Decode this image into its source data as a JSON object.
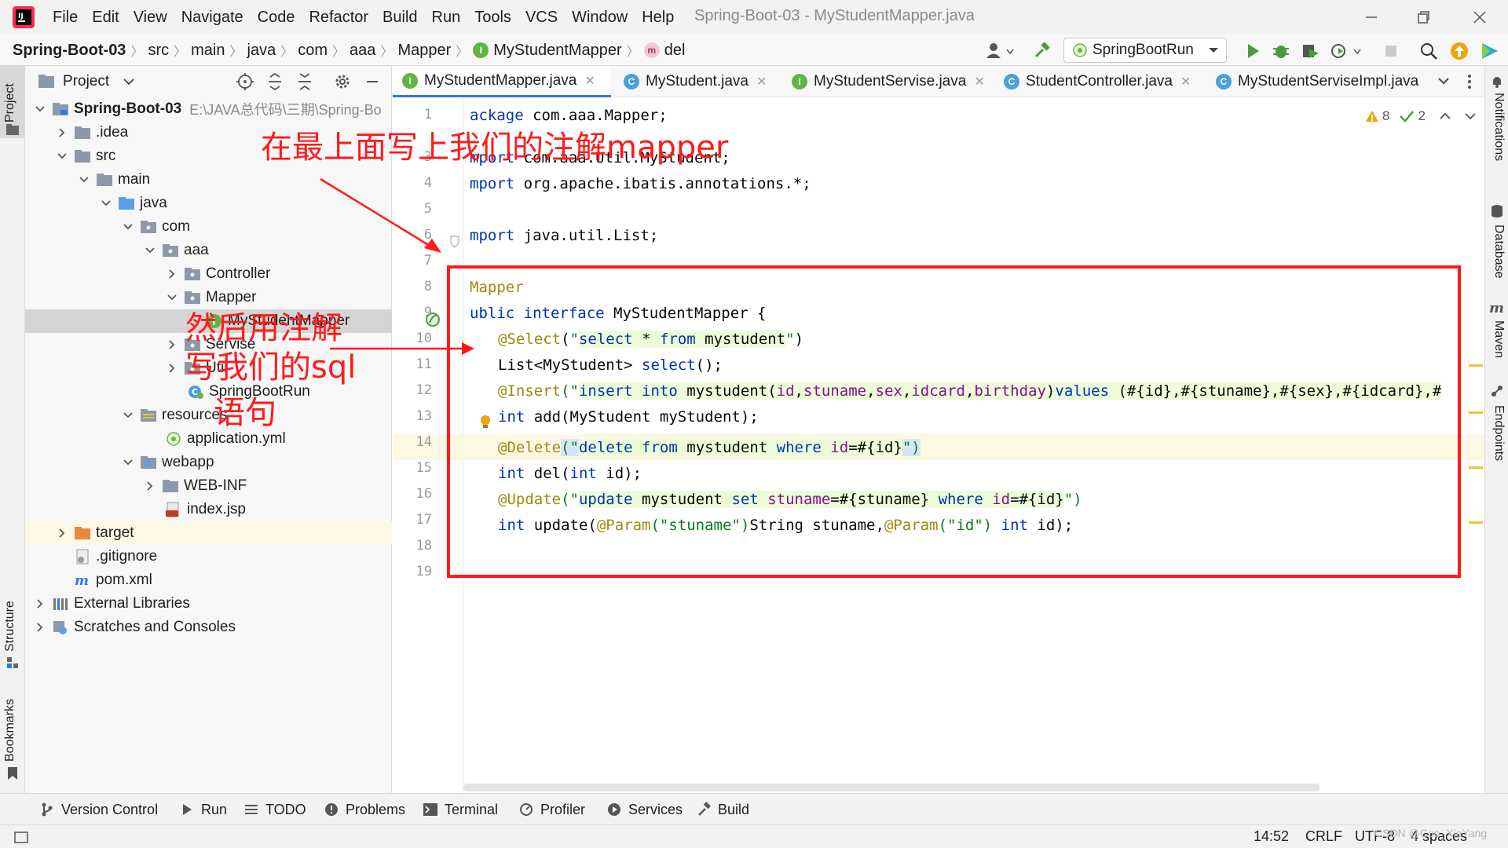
{
  "window": {
    "title": "Spring-Boot-03 - MyStudentMapper.java",
    "menus": [
      "File",
      "Edit",
      "View",
      "Navigate",
      "Code",
      "Refactor",
      "Build",
      "Run",
      "Tools",
      "VCS",
      "Window",
      "Help"
    ]
  },
  "navbar": {
    "crumbs": [
      "Spring-Boot-03",
      "src",
      "main",
      "java",
      "com",
      "aaa",
      "Mapper",
      "MyStudentMapper",
      "del"
    ],
    "run_config": "SpringBootRun"
  },
  "project": {
    "header": "Project",
    "tree": [
      {
        "label": "Spring-Boot-03",
        "path": "E:\\JAVA总代码\\三期\\Spring-Bo"
      },
      {
        "label": ".idea"
      },
      {
        "label": "src"
      },
      {
        "label": "main"
      },
      {
        "label": "java"
      },
      {
        "label": "com"
      },
      {
        "label": "aaa"
      },
      {
        "label": "Controller"
      },
      {
        "label": "Mapper"
      },
      {
        "label": "MyStudentMapper"
      },
      {
        "label": "Servise"
      },
      {
        "label": "Util"
      },
      {
        "label": "SpringBootRun"
      },
      {
        "label": "resources"
      },
      {
        "label": "application.yml"
      },
      {
        "label": "webapp"
      },
      {
        "label": "WEB-INF"
      },
      {
        "label": "index.jsp"
      },
      {
        "label": "target"
      },
      {
        "label": ".gitignore"
      },
      {
        "label": "pom.xml"
      },
      {
        "label": "External Libraries"
      },
      {
        "label": "Scratches and Consoles"
      }
    ]
  },
  "tabs": [
    "MyStudentMapper.java",
    "MyStudent.java",
    "MyStudentServise.java",
    "StudentController.java",
    "MyStudentServiseImpl.java"
  ],
  "editor": {
    "line_numbers": [
      "1",
      "3",
      "4",
      "5",
      "6",
      "7",
      "8",
      "9",
      "10",
      "11",
      "12",
      "13",
      "14",
      "15",
      "16",
      "17",
      "18",
      "19"
    ],
    "inspections": {
      "warnings": "8",
      "checks": "2"
    },
    "lines": {
      "l1_kw": "ackage",
      "l1_tx": " com.aaa.Mapper;",
      "l3_kw": "mport",
      "l3_tx": " com.aaa.Util.MyStudent;",
      "l4_kw": "mport",
      "l4_tx": " org.apache.ibatis.annotations.*;",
      "l6_kw": "mport",
      "l6_tx": " java.util.List;",
      "l8_an": "Mapper",
      "l9_kw1": "ublic",
      "l9_kw2": " interface",
      "l9_tx": " MyStudentMapper {",
      "l10_an": "@Select",
      "l10_p1": "(",
      "l10_q1": "\"",
      "l10_s1": "select",
      "l10_s2": " * ",
      "l10_s3": "from",
      "l10_s4": " mystudent",
      "l10_q2": "\"",
      "l10_p2": ")",
      "l11_tx": "List<MyStudent> ",
      "l11_m": "select",
      "l11_tx2": "();",
      "l12_an": "@Insert",
      "l12_p1": "(\"",
      "l12_a": "insert into",
      "l12_b": " mystudent(",
      "l12_c": "id",
      "l12_d": ",",
      "l12_e": "stuname",
      "l12_f": ",",
      "l12_g": "sex",
      "l12_h": ",",
      "l12_i": "idcard",
      "l12_j": ",",
      "l12_k": "birthday",
      "l12_l": ")",
      "l12_m": "values",
      "l12_n": " (#{id},#{stuname},#{sex},#{idcard},#",
      "l13_kw": "int",
      "l13_tx": " add(MyStudent myStudent);",
      "l14_an": "@Delete",
      "l14_p1": "(\"",
      "l14_a": "delete from",
      "l14_b": " mystudent ",
      "l14_c": "where",
      "l14_d": " id",
      "l14_e": "=#{id}",
      "l14_p2": "\")",
      "l15_kw": "int",
      "l15_tx": " del(",
      "l15_kw2": "int",
      "l15_tx2": " id);",
      "l16_an": "@Update",
      "l16_p1": "(\"",
      "l16_a": "update",
      "l16_b": " mystudent ",
      "l16_c": "set",
      "l16_d": " stuname",
      "l16_e": "=#{stuname} ",
      "l16_f": "where",
      "l16_g": " id",
      "l16_h": "=#{id}",
      "l16_p2": "\")",
      "l17_kw": "int",
      "l17_tx": " update(",
      "l17_an": "@Param",
      "l17_s1": "(\"stuname\")",
      "l17_tx2": "String stuname,",
      "l17_an2": "@Param",
      "l17_s2": "(\"id\")",
      "l17_kw2": " int",
      "l17_tx3": " id);"
    }
  },
  "right_strip": [
    "Notifications",
    "Database",
    "Maven",
    "Endpoints"
  ],
  "left_strip": [
    "Project",
    "Structure",
    "Bookmarks"
  ],
  "bottom_tools": [
    "Version Control",
    "Run",
    "TODO",
    "Problems",
    "Terminal",
    "Profiler",
    "Services",
    "Build"
  ],
  "status": {
    "position": "14:52",
    "line_sep": "CRLF",
    "encoding": "UTF-8",
    "indent": "4 spaces",
    "watermark": "CSDN @Coo_XieYang"
  },
  "annotations": {
    "top": "在最上面写上我们的注解mapper",
    "mid1": "然后用注解",
    "mid2": "写我们的sql",
    "mid3": "语句"
  },
  "colors": {
    "annotation": "#ff1a1a",
    "accent": "#3574f0",
    "keyword": "#0033b3",
    "annotation_code": "#9e880d",
    "string": "#067d17"
  }
}
